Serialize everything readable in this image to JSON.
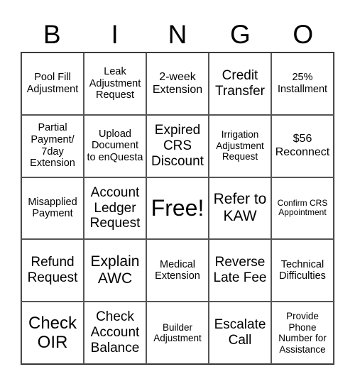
{
  "header": {
    "letters": [
      "B",
      "I",
      "N",
      "G",
      "O"
    ]
  },
  "cells": [
    [
      "Pool Fill Adjustment",
      "Leak Adjustment Request",
      "2-week Extension",
      "Credit Transfer",
      "25% Installment"
    ],
    [
      "Partial Payment/ 7day Extension",
      "Upload Document to enQuesta",
      "Expired CRS Discount",
      "Irrigation Adjustment Request",
      "$56 Reconnect"
    ],
    [
      "Misapplied Payment",
      "Account Ledger Request",
      "Free!",
      "Refer to KAW",
      "Confirm CRS Appointment"
    ],
    [
      "Refund Request",
      "Explain AWC",
      "Medical Extension",
      "Reverse Late Fee",
      "Technical Difficulties"
    ],
    [
      "Check OIR",
      "Check Account Balance",
      "Builder Adjustment",
      "Escalate Call",
      "Provide Phone Number for Assistance"
    ]
  ]
}
